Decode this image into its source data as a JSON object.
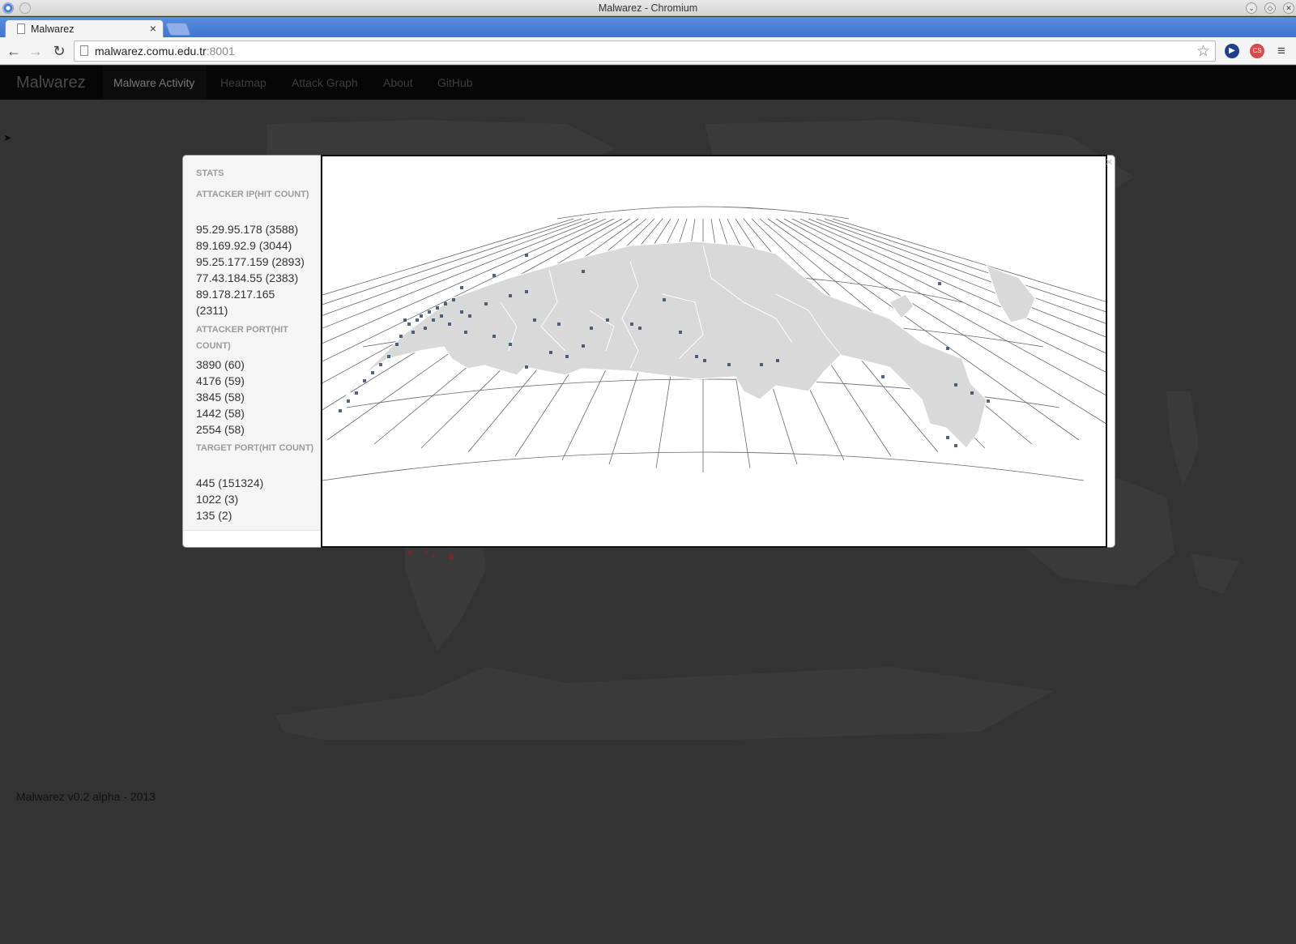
{
  "window": {
    "title": "Malwarez - Chromium"
  },
  "tab": {
    "label": "Malwarez",
    "close": "×"
  },
  "address": {
    "host": "malwarez.comu.edu.tr",
    "port": ":8001"
  },
  "nav": {
    "brand": "Malwarez",
    "links": [
      "Malware Activity",
      "Heatmap",
      "Attack Graph",
      "About",
      "GitHub"
    ],
    "active": "Malware Activity"
  },
  "stats": {
    "title": "STATS",
    "attacker_ip_heading": "ATTACKER IP(HIT COUNT)",
    "attacker_ips": [
      "95.29.95.178 (3588)",
      "89.169.92.9 (3044)",
      "95.25.177.159 (2893)",
      "77.43.184.55 (2383)",
      "89.178.217.165 (2311)"
    ],
    "attacker_port_heading": "ATTACKER PORT(HIT COUNT)",
    "attacker_ports": [
      "3890 (60)",
      "4176 (59)",
      "3845 (58)",
      "1442 (58)",
      "2554 (58)"
    ],
    "target_port_heading": "TARGET PORT(HIT COUNT)",
    "target_ports": [
      "445 (151324)",
      "1022 (3)",
      "135 (2)"
    ]
  },
  "modal": {
    "close": "×"
  },
  "footer": {
    "text": "Malwarez v0.2 alpha - 2013"
  },
  "colors": {
    "page_bg": "#333333",
    "land_dark": "#3a3a3a",
    "land_globe": "#d9d9d9",
    "marker": "#2a3f5c",
    "navbar": "#060606"
  }
}
